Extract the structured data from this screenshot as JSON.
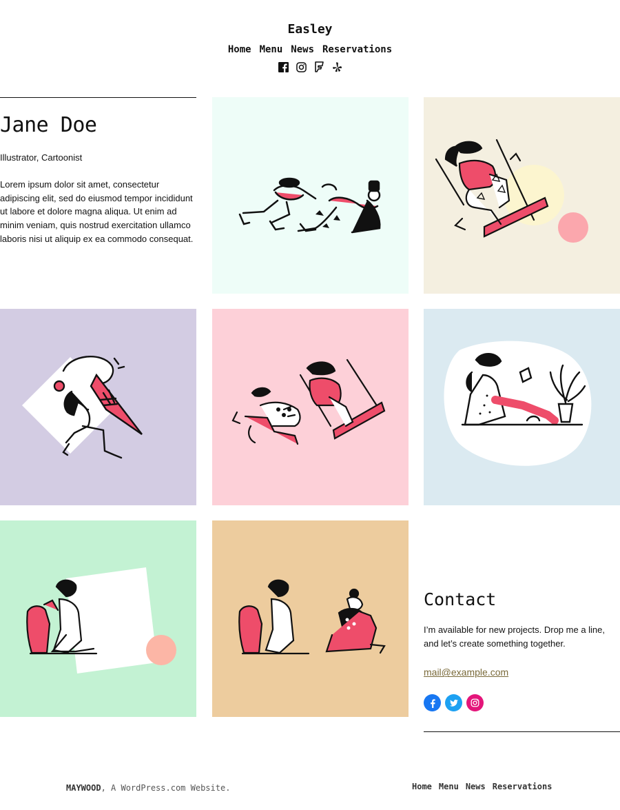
{
  "site": {
    "title": "Easley"
  },
  "nav": {
    "items": [
      "Home",
      "Menu",
      "News",
      "Reservations"
    ]
  },
  "header_socials": [
    "facebook-icon",
    "instagram-icon",
    "foursquare-icon",
    "yelp-icon"
  ],
  "bio": {
    "name": "Jane Doe",
    "role": "Illustrator, Cartoonist",
    "description": "Lorem ipsum dolor sit amet, consectetur adipiscing elit, sed do eiusmod tempor incididunt ut labore et dolore magna aliqua. Ut enim ad minim veniam, quis nostrud exercitation ullamco laboris nisi ut aliquip ex ea commodo consequat."
  },
  "gallery": [
    {
      "name": "illustration-chase",
      "bg": "#eefdf8"
    },
    {
      "name": "illustration-swing",
      "bg": "#f4efe0"
    },
    {
      "name": "illustration-ice-cream",
      "bg": "#d3cce3"
    },
    {
      "name": "illustration-swing-duo",
      "bg": "#fdd0d8"
    },
    {
      "name": "illustration-reading",
      "bg": "#dbeaf1"
    },
    {
      "name": "illustration-dog-friend",
      "bg": "#c3f2d3"
    },
    {
      "name": "illustration-friends",
      "bg": "#edcc9e"
    }
  ],
  "contact": {
    "title": "Contact",
    "text": "I’m available for new projects. Drop me a line, and let’s create something together.",
    "email": "mail@example.com",
    "icons": [
      {
        "name": "facebook-icon",
        "color": "#1877f2"
      },
      {
        "name": "twitter-icon",
        "color": "#1da1f2"
      },
      {
        "name": "instagram-icon",
        "color": "#e4157a"
      }
    ]
  },
  "footer": {
    "brand": "MAYWOOD",
    "tagline": ", A WordPress.com Website.",
    "nav": [
      "Home",
      "Menu",
      "News",
      "Reservations"
    ]
  },
  "colors": {
    "accent_pink": "#ee4d6a",
    "link_brown": "#7a6a3a"
  }
}
